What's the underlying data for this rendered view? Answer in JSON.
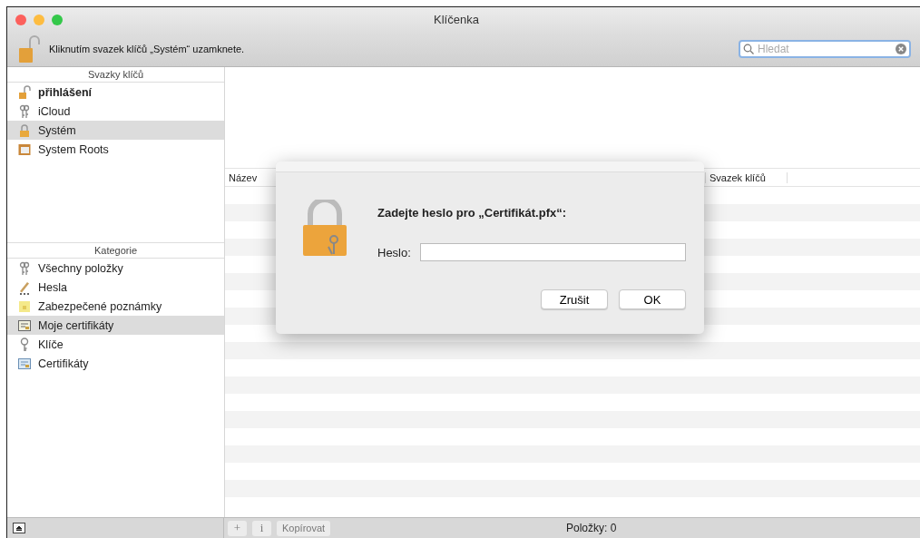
{
  "window": {
    "title": "Klíčenka"
  },
  "toolbar": {
    "lock_message": "Kliknutím svazek klíčů „Systém“ uzamknete.",
    "search": {
      "placeholder": "Hledat"
    }
  },
  "keychains": {
    "header": "Svazky klíčů",
    "items": [
      {
        "label": "přihlášení",
        "kind": "unlocked",
        "default": true,
        "selected": false
      },
      {
        "label": "iCloud",
        "kind": "keys",
        "default": false,
        "selected": false
      },
      {
        "label": "Systém",
        "kind": "locked",
        "default": false,
        "selected": true
      },
      {
        "label": "System Roots",
        "kind": "cabinet",
        "default": false,
        "selected": false
      }
    ]
  },
  "categories": {
    "header": "Kategorie",
    "items": [
      {
        "label": "Všechny položky",
        "kind": "keys",
        "selected": false
      },
      {
        "label": "Hesla",
        "kind": "pencil",
        "selected": false
      },
      {
        "label": "Zabezpečené poznámky",
        "kind": "note",
        "selected": false
      },
      {
        "label": "Moje certifikáty",
        "kind": "mycert",
        "selected": true
      },
      {
        "label": "Klíče",
        "kind": "key",
        "selected": false
      },
      {
        "label": "Certifikáty",
        "kind": "cert",
        "selected": false
      }
    ]
  },
  "table": {
    "columns": [
      "Název",
      "Svazek klíčů"
    ]
  },
  "dialog": {
    "prompt": "Zadejte heslo pro „Certifikát.pfx“:",
    "field_label": "Heslo:",
    "buttons": [
      "Zrušit",
      "OK"
    ]
  },
  "bottom_bar": {
    "add": "+",
    "info": "i",
    "copy_button": "Kopírovat",
    "count": "Položky: 0"
  }
}
